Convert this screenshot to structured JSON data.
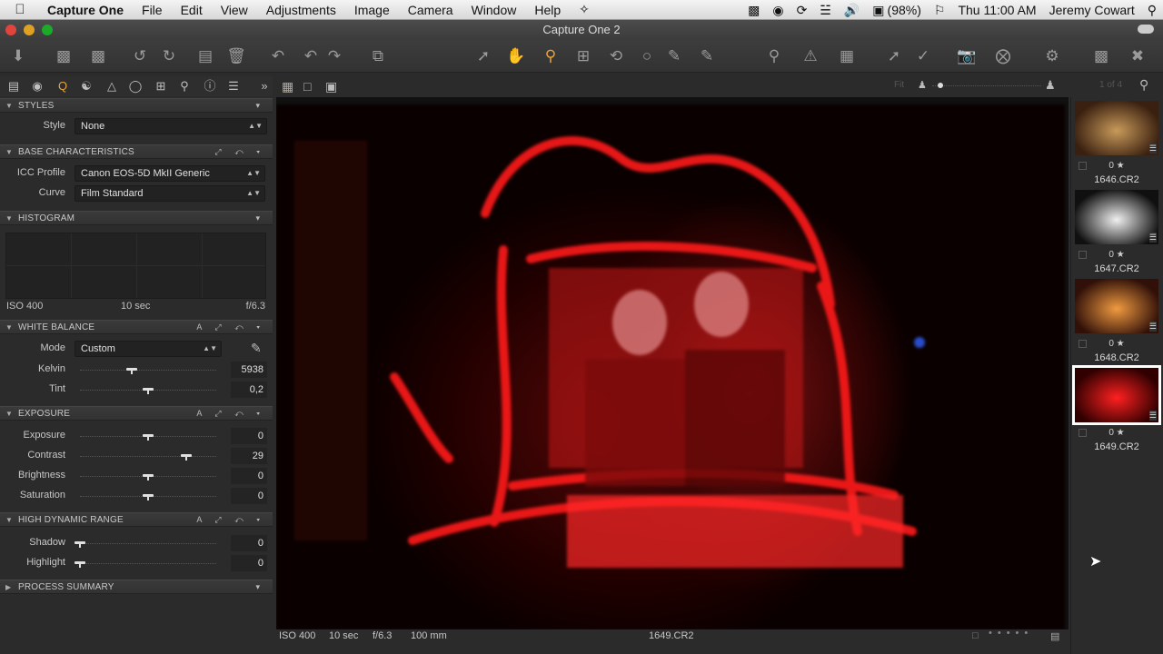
{
  "menubar": {
    "apple": "",
    "items": [
      "Capture One",
      "File",
      "Edit",
      "View",
      "Adjustments",
      "Image",
      "Camera",
      "Window",
      "Help"
    ],
    "battery": "(98%)",
    "clock": "Thu 11:00 AM",
    "user": "Jeremy Cowart"
  },
  "window": {
    "title": "Capture One 2"
  },
  "viewerbar": {
    "fit": "Fit",
    "count": "1 of 4"
  },
  "panel": {
    "styles": {
      "header": "STYLES",
      "style_label": "Style",
      "style_value": "None"
    },
    "base": {
      "header": "BASE CHARACTERISTICS",
      "icc_label": "ICC Profile",
      "icc_value": "Canon EOS-5D MkII Generic",
      "curve_label": "Curve",
      "curve_value": "Film Standard"
    },
    "histogram": {
      "header": "HISTOGRAM",
      "iso": "ISO 400",
      "shutter": "10 sec",
      "aperture": "f/6.3"
    },
    "wb": {
      "header": "WHITE BALANCE",
      "mode_label": "Mode",
      "mode_value": "Custom",
      "sliders": [
        {
          "label": "Kelvin",
          "value": "5938",
          "level": 0.38
        },
        {
          "label": "Tint",
          "value": "0,2",
          "level": 0.5
        }
      ]
    },
    "exposure": {
      "header": "EXPOSURE",
      "sliders": [
        {
          "label": "Exposure",
          "value": "0",
          "level": 0.5
        },
        {
          "label": "Contrast",
          "value": "29",
          "level": 0.78
        },
        {
          "label": "Brightness",
          "value": "0",
          "level": 0.5
        },
        {
          "label": "Saturation",
          "value": "0",
          "level": 0.5
        }
      ]
    },
    "hdr": {
      "header": "HIGH DYNAMIC RANGE",
      "sliders": [
        {
          "label": "Shadow",
          "value": "0",
          "level": 0
        },
        {
          "label": "Highlight",
          "value": "0",
          "level": 0
        }
      ]
    },
    "process": {
      "header": "PROCESS SUMMARY"
    }
  },
  "status": {
    "iso": "ISO 400",
    "shutter": "10 sec",
    "aperture": "f/6.3",
    "focal": "100 mm",
    "filename": "1649.CR2"
  },
  "filmstrip": [
    {
      "rating": "0 ★",
      "name": "1646.CR2",
      "colors": [
        "#c89a5a",
        "#3a2010"
      ]
    },
    {
      "rating": "0 ★",
      "name": "1647.CR2",
      "colors": [
        "#f0f0f0",
        "#101010"
      ]
    },
    {
      "rating": "0 ★",
      "name": "1648.CR2",
      "colors": [
        "#f09a40",
        "#301008"
      ]
    },
    {
      "rating": "0 ★",
      "name": "1649.CR2",
      "colors": [
        "#ff2020",
        "#300000"
      ]
    }
  ],
  "colors": {
    "accent": "#e8a33d",
    "selected_border": "#ffffff"
  }
}
